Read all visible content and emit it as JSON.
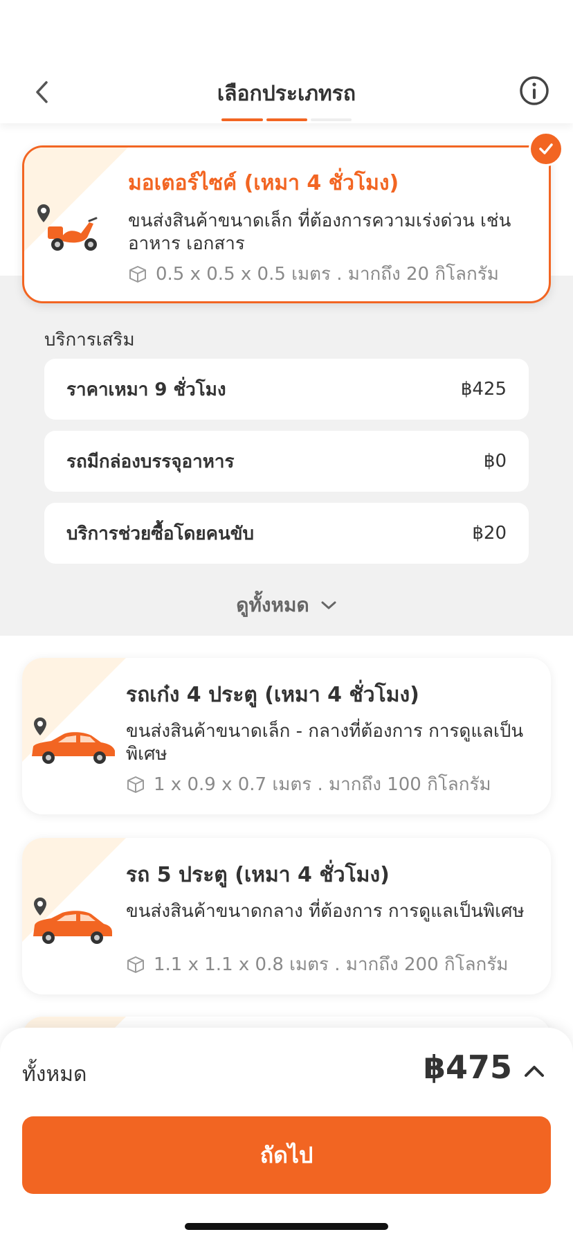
{
  "header": {
    "title": "เลือกประเภทรถ",
    "back_icon": "chevron-left-icon",
    "info_icon": "info-circle-icon",
    "progress_steps": 3,
    "progress_current": 2
  },
  "colors": {
    "accent": "#f26522",
    "accent_light": "#fff3e3",
    "section_bg": "#f1f1f1",
    "text": "#333333",
    "muted": "#8a8a8a"
  },
  "vehicles": [
    {
      "name": "มอเตอร์ไซค์ (เหมา 4 ชั่วโมง)",
      "description": "ขนส่งสินค้าขนาดเล็ก ที่ต้องการความเร่งด่วน เช่น อาหาร เอกสาร",
      "spec": "0.5 x 0.5 x 0.5 เมตร . มากถึง 20 กิโลกรัม",
      "icon": "motorcycle-icon",
      "selected": true
    },
    {
      "name": "รถเก๋ง 4 ประตู (เหมา 4 ชั่วโมง)",
      "description": "ขนส่งสินค้าขนาดเล็ก - กลางที่ต้องการ การดูแลเป็นพิเศษ",
      "spec": "1 x 0.9 x 0.7 เมตร . มากถึง 100 กิโลกรัม",
      "icon": "sedan-car-icon",
      "selected": false
    },
    {
      "name": "รถ 5 ประตู (เหมา 4 ชั่วโมง)",
      "description": "ขนส่งสินค้าขนาดกลาง ที่ต้องการ การดูแลเป็นพิเศษ",
      "spec": "1.1 x 1.1 x 0.8 เมตร . มากถึง 200 กิโลกรัม",
      "icon": "hatchback-car-icon",
      "selected": false
    }
  ],
  "addons": {
    "title": "บริการเสริม",
    "items": [
      {
        "label": "ราคาเหมา 9 ชั่วโมง",
        "price": "฿425"
      },
      {
        "label": "รถมีกล่องบรรจุอาหาร",
        "price": "฿0"
      },
      {
        "label": "บริการช่วยซื้อโดยคนขับ",
        "price": "฿20"
      }
    ],
    "see_all_label": "ดูทั้งหมด"
  },
  "footer": {
    "total_label": "ทั้งหมด",
    "total_price": "฿475",
    "next_label": "ถัดไป"
  }
}
